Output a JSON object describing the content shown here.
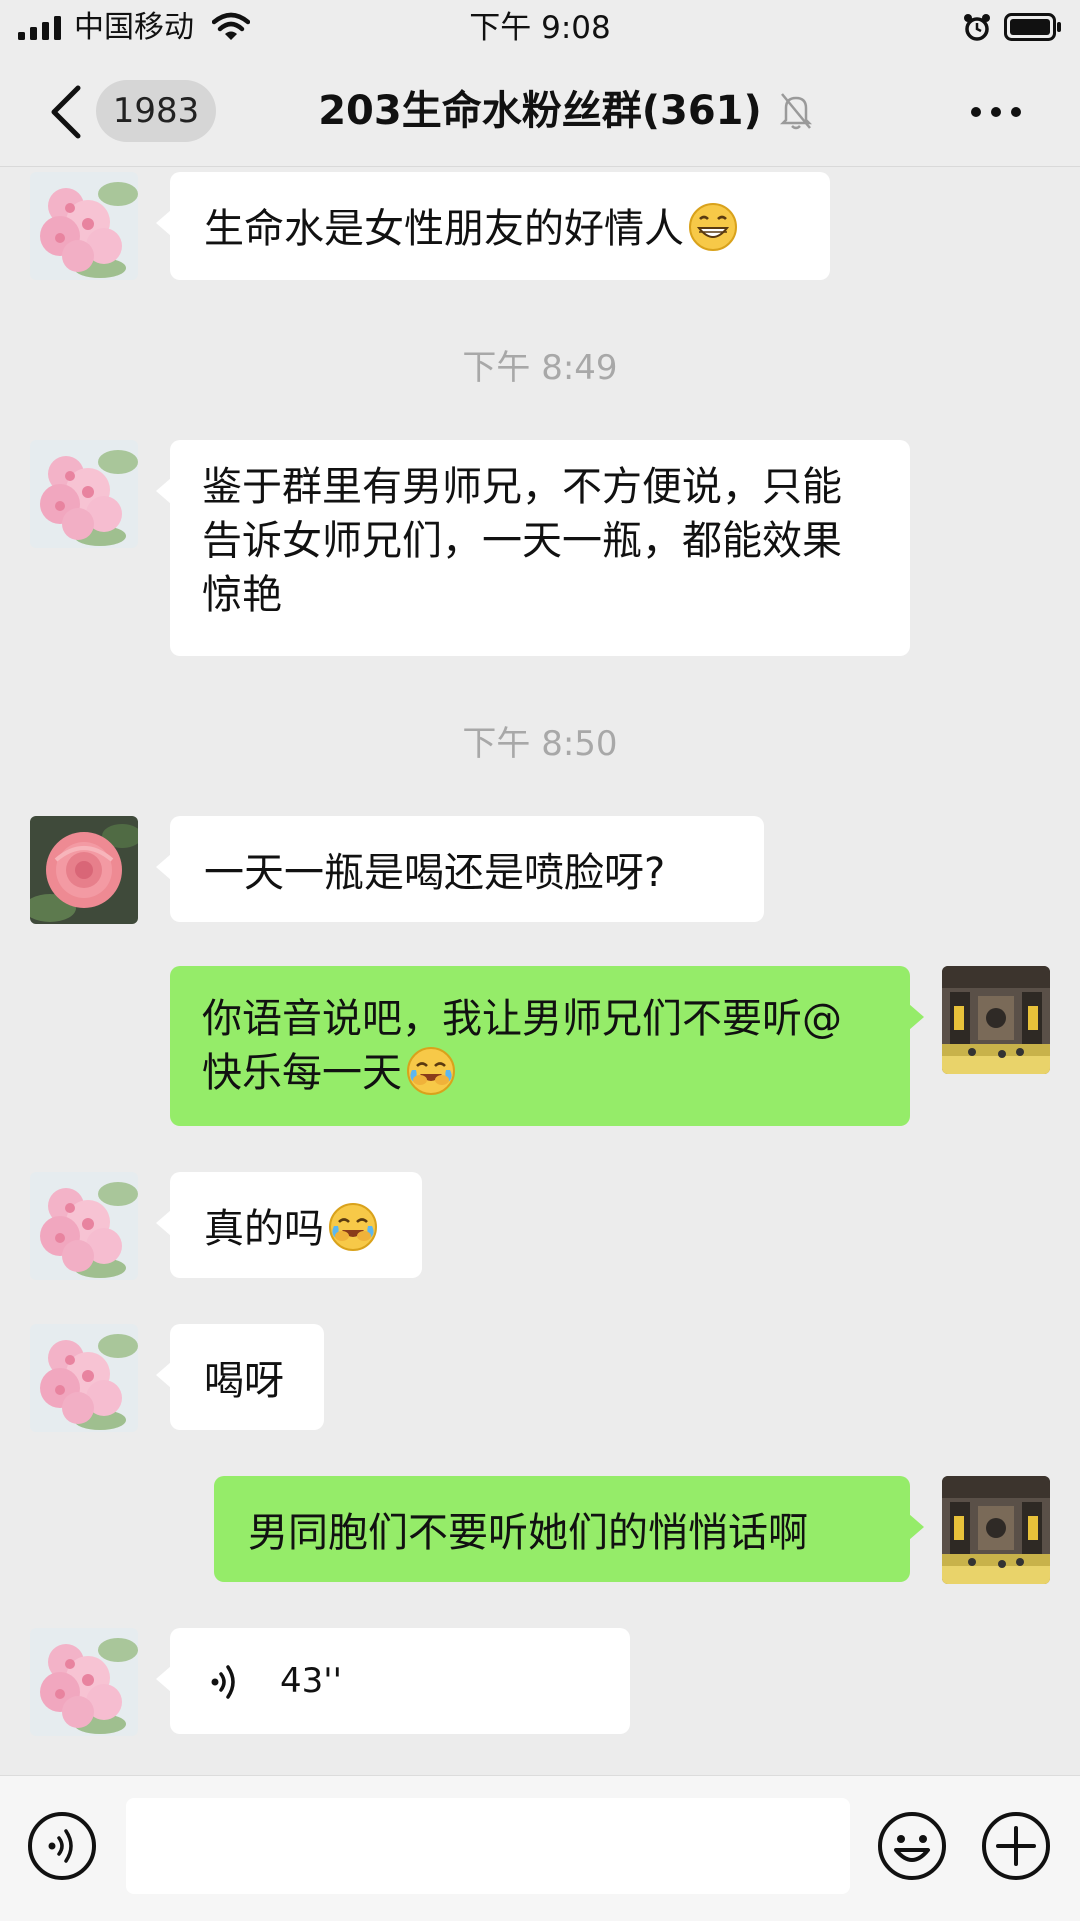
{
  "status_bar": {
    "carrier": "中国移动",
    "time": "下午 9:08"
  },
  "header": {
    "unread_count": "1983",
    "title": "203生命水粉丝群(361)"
  },
  "messages": [
    {
      "side": "left",
      "avatar": "pink-blossom-avatar",
      "text": "生命水是女性朋友的好情人",
      "emoji": "grinning-emoji"
    },
    {
      "type": "timestamp",
      "text": "下午 8:49"
    },
    {
      "side": "left",
      "avatar": "pink-blossom-avatar",
      "text": "鉴于群里有男师兄，不方便说，只能告诉女师兄们，一天一瓶，都能效果惊艳"
    },
    {
      "type": "timestamp",
      "text": "下午 8:50"
    },
    {
      "side": "left",
      "avatar": "pink-camellia-avatar",
      "text": "一天一瓶是喝还是喷脸呀?"
    },
    {
      "side": "right",
      "avatar": "temple-hall-avatar",
      "text": "你语音说吧，我让男师兄们不要听@快乐每一天",
      "emoji": "laugh-cry-emoji"
    },
    {
      "side": "left",
      "avatar": "pink-blossom-avatar",
      "text": "真的吗",
      "emoji": "laugh-cry-emoji"
    },
    {
      "side": "left",
      "avatar": "pink-blossom-avatar",
      "text": "喝呀"
    },
    {
      "side": "right",
      "avatar": "temple-hall-avatar",
      "text": "男同胞们不要听她们的悄悄话啊"
    },
    {
      "side": "left",
      "avatar": "pink-blossom-avatar",
      "type": "voice",
      "duration": "43''"
    }
  ],
  "colors": {
    "background": "#ececec",
    "bubble_self": "#95ec69",
    "bubble_other": "#ffffff",
    "timestamp": "#a8a8a8"
  },
  "input_bar": {
    "icons": [
      "voice-mode-icon",
      "emoji-icon",
      "plus-icon"
    ]
  }
}
